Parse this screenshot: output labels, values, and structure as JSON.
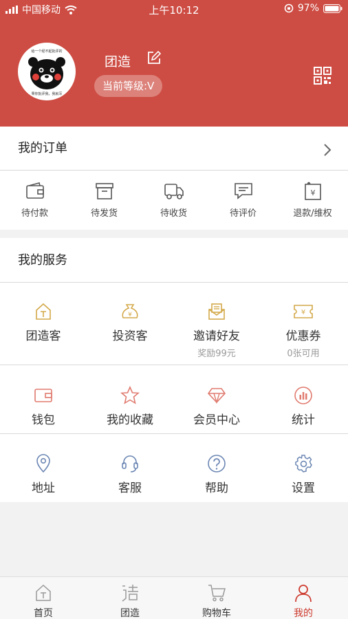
{
  "status_bar": {
    "carrier": "中国移动",
    "time": "上午10:12",
    "battery": "97%"
  },
  "profile": {
    "username": "团造",
    "level": "当前等级:V",
    "avatar_top_text": "给一个经不起批评的",
    "avatar_bottom_text": "果你批评我，我就写"
  },
  "orders": {
    "title": "我的订单",
    "items": [
      {
        "label": "待付款",
        "icon": "wallet-icon"
      },
      {
        "label": "待发货",
        "icon": "box-icon"
      },
      {
        "label": "待收货",
        "icon": "truck-icon"
      },
      {
        "label": "待评价",
        "icon": "comment-icon"
      },
      {
        "label": "退款/维权",
        "icon": "refund-icon"
      }
    ]
  },
  "services": {
    "title": "我的服务",
    "row1": [
      {
        "label": "团造客",
        "sub": "",
        "icon": "house-icon"
      },
      {
        "label": "投资客",
        "sub": "",
        "icon": "money-bag-icon"
      },
      {
        "label": "邀请好友",
        "sub": "奖励99元",
        "icon": "envelope-icon"
      },
      {
        "label": "优惠券",
        "sub": "0张可用",
        "icon": "coupon-icon"
      }
    ],
    "row2": [
      {
        "label": "钱包",
        "icon": "wallet-icon"
      },
      {
        "label": "我的收藏",
        "icon": "star-icon"
      },
      {
        "label": "会员中心",
        "icon": "diamond-icon"
      },
      {
        "label": "统计",
        "icon": "stats-icon"
      }
    ],
    "row3": [
      {
        "label": "地址",
        "icon": "location-icon"
      },
      {
        "label": "客服",
        "icon": "headset-icon"
      },
      {
        "label": "帮助",
        "icon": "help-icon"
      },
      {
        "label": "设置",
        "icon": "gear-icon"
      }
    ]
  },
  "tabbar": [
    {
      "label": "首页",
      "icon": "home-icon"
    },
    {
      "label": "团造",
      "icon": "tuanzao-icon"
    },
    {
      "label": "购物车",
      "icon": "cart-icon"
    },
    {
      "label": "我的",
      "icon": "user-icon"
    }
  ],
  "colors": {
    "brand": "#cd4c43",
    "gold": "#d4a94a",
    "coral": "#e07a6e",
    "blue": "#6b86b3"
  }
}
